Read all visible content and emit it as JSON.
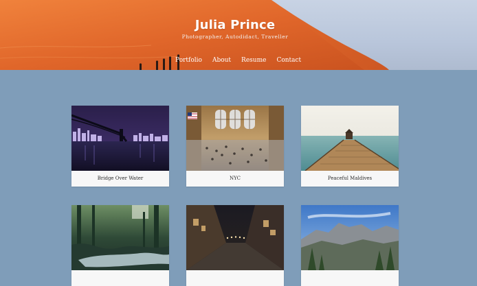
{
  "site": {
    "title": "Julia Prince",
    "tagline": "Photographer, Autodidact, Traveller"
  },
  "nav": [
    {
      "label": "Portfolio"
    },
    {
      "label": "About"
    },
    {
      "label": "Resume"
    },
    {
      "label": "Contact"
    }
  ],
  "gallery": [
    {
      "caption": "Bridge Over Water",
      "image": "night-bridge-city-photo"
    },
    {
      "caption": "NYC",
      "image": "grand-central-terminal-photo"
    },
    {
      "caption": "Peaceful Maldives",
      "image": "wooden-pier-sea-photo"
    },
    {
      "caption": "",
      "image": "forest-river-photo"
    },
    {
      "caption": "",
      "image": "night-street-photo"
    },
    {
      "caption": "",
      "image": "mountain-valley-photo"
    }
  ],
  "colors": {
    "background": "#7f9db9",
    "card": "#f7f7f7",
    "dune": "#e2692a",
    "sky": "#c8d3e4"
  }
}
